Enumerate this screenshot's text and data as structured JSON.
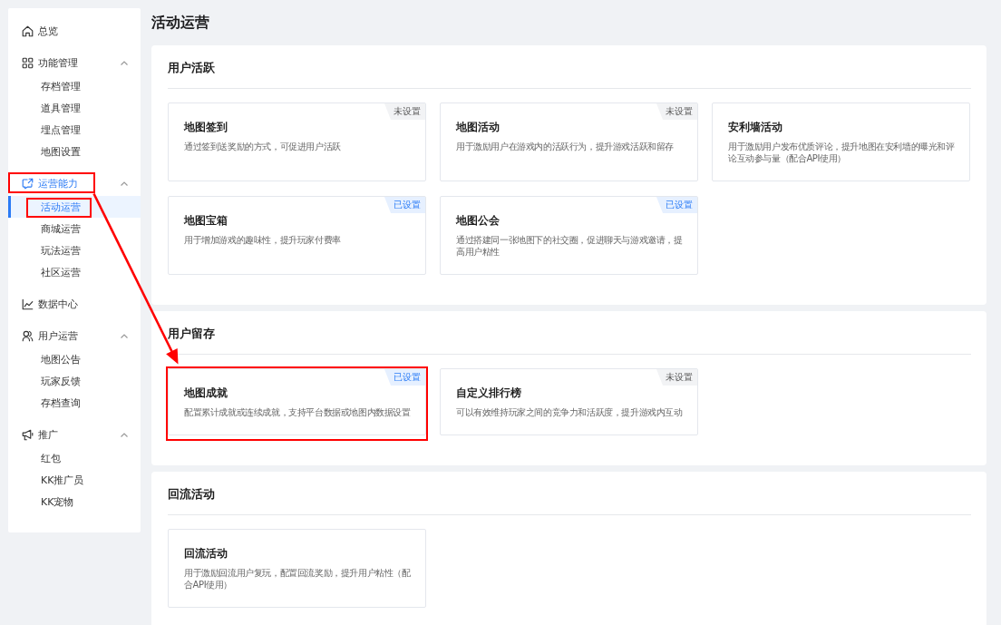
{
  "sidebar": {
    "items": [
      {
        "kind": "link",
        "label": "总览",
        "selected": false,
        "annotated": false
      },
      {
        "kind": "group",
        "label": "功能管理",
        "expanded": true,
        "annotated": false,
        "children": [
          {
            "label": "存档管理",
            "selected": false,
            "annotated": false
          },
          {
            "label": "道具管理",
            "selected": false,
            "annotated": false
          },
          {
            "label": "埋点管理",
            "selected": false,
            "annotated": false
          },
          {
            "label": "地图设置",
            "selected": false,
            "annotated": false
          }
        ]
      },
      {
        "kind": "group",
        "label": "运营能力",
        "expanded": true,
        "annotated": true,
        "children": [
          {
            "label": "活动运营",
            "selected": true,
            "annotated": true
          },
          {
            "label": "商城运营",
            "selected": false,
            "annotated": false
          },
          {
            "label": "玩法运营",
            "selected": false,
            "annotated": false
          },
          {
            "label": "社区运营",
            "selected": false,
            "annotated": false
          }
        ]
      },
      {
        "kind": "link",
        "label": "数据中心",
        "selected": false,
        "annotated": false
      },
      {
        "kind": "group",
        "label": "用户运营",
        "expanded": true,
        "annotated": false,
        "children": [
          {
            "label": "地图公告",
            "selected": false,
            "annotated": false
          },
          {
            "label": "玩家反馈",
            "selected": false,
            "annotated": false
          },
          {
            "label": "存档查询",
            "selected": false,
            "annotated": false
          }
        ]
      },
      {
        "kind": "group",
        "label": "推广",
        "expanded": true,
        "annotated": false,
        "children": [
          {
            "label": "红包",
            "selected": false,
            "annotated": false
          },
          {
            "label": "KK推广员",
            "selected": false,
            "annotated": false
          },
          {
            "label": "KK宠物",
            "selected": false,
            "annotated": false
          }
        ]
      }
    ]
  },
  "page_title": "活动运营",
  "sections": [
    {
      "title": "用户活跃",
      "cards": [
        {
          "title": "地图签到",
          "description": "通过签到送奖励的方式，可促进用户活跃",
          "status": "未设置",
          "configured": false,
          "annotated": false
        },
        {
          "title": "地图活动",
          "description": "用于激励用户在游戏内的活跃行为，提升游戏活跃和留存",
          "status": "未设置",
          "configured": false,
          "annotated": false
        },
        {
          "title": "安利墙活动",
          "description": "用于激励用户发布优质评论，提升地图在安利墙的曝光和评论互动参与量（配合API使用）",
          "annotated": false
        },
        {
          "title": "地图宝箱",
          "description": "用于增加游戏的趣味性，提升玩家付费率",
          "status": "已设置",
          "configured": true,
          "annotated": false
        },
        {
          "title": "地图公会",
          "description": "通过搭建同一张地图下的社交圈，促进聊天与游戏邀请，提高用户粘性",
          "status": "已设置",
          "configured": true,
          "annotated": false
        }
      ]
    },
    {
      "title": "用户留存",
      "cards": [
        {
          "title": "地图成就",
          "description": "配置累计成就或连续成就，支持平台数据或地图内数据设置",
          "status": "已设置",
          "configured": true,
          "annotated": true
        },
        {
          "title": "自定义排行榜",
          "description": "可以有效维持玩家之间的竞争力和活跃度，提升游戏内互动",
          "status": "未设置",
          "configured": false,
          "annotated": false
        }
      ]
    },
    {
      "title": "回流活动",
      "cards": [
        {
          "title": "回流活动",
          "description": "用于激励回流用户复玩，配置回流奖励，提升用户粘性（配合API使用）",
          "annotated": false
        }
      ]
    }
  ],
  "annotation_arrow": true
}
